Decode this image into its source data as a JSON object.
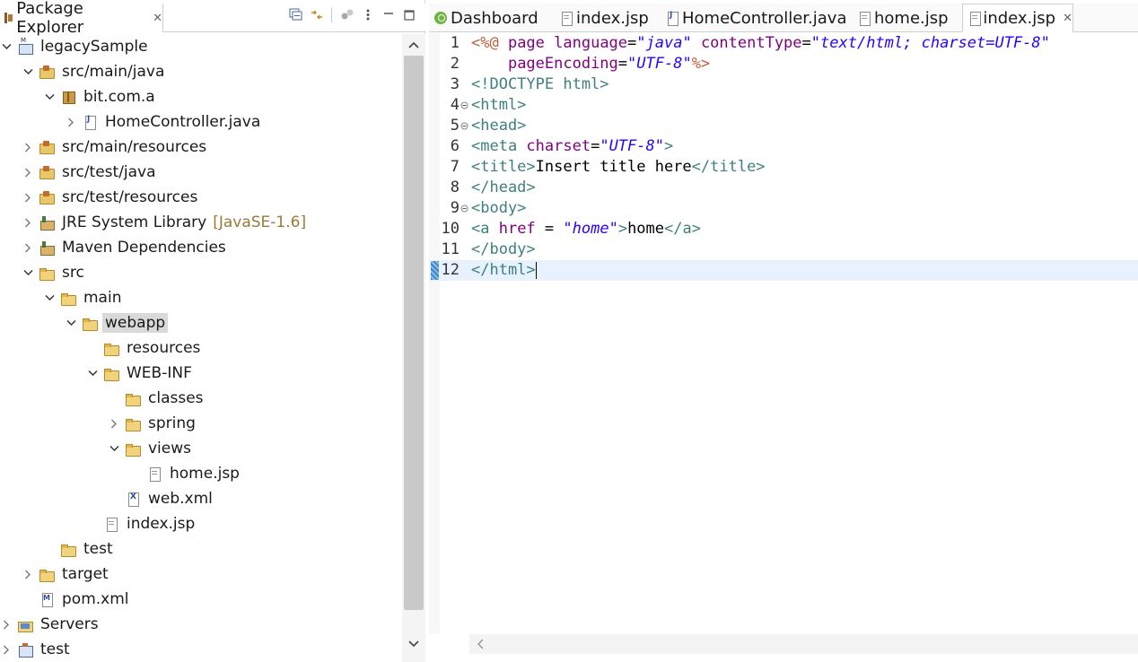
{
  "explorer": {
    "title": "Package Explorer",
    "close_glyph": "✕",
    "tree": [
      {
        "label": "legacySample",
        "icon": "project-icon",
        "twisty": "expanded"
      },
      {
        "label": "src/main/java",
        "icon": "source-folder-icon",
        "twisty": "expanded"
      },
      {
        "label": "bit.com.a",
        "icon": "package-icon",
        "twisty": "expanded"
      },
      {
        "label": "HomeController.java",
        "icon": "java-file-icon",
        "twisty": "collapsed"
      },
      {
        "label": "src/main/resources",
        "icon": "source-folder-icon",
        "twisty": "collapsed"
      },
      {
        "label": "src/test/java",
        "icon": "source-folder-icon",
        "twisty": "collapsed"
      },
      {
        "label": "src/test/resources",
        "icon": "source-folder-icon",
        "twisty": "collapsed"
      },
      {
        "label": "JRE System Library",
        "decor": "[JavaSE-1.6]",
        "icon": "library-icon",
        "twisty": "collapsed"
      },
      {
        "label": "Maven Dependencies",
        "icon": "library-icon",
        "twisty": "collapsed"
      },
      {
        "label": "src",
        "icon": "folder-icon",
        "twisty": "expanded"
      },
      {
        "label": "main",
        "icon": "folder-icon",
        "twisty": "expanded"
      },
      {
        "label": "webapp",
        "icon": "folder-icon",
        "twisty": "expanded",
        "selected": true
      },
      {
        "label": "resources",
        "icon": "folder-icon",
        "twisty": "none"
      },
      {
        "label": "WEB-INF",
        "icon": "folder-icon",
        "twisty": "expanded"
      },
      {
        "label": "classes",
        "icon": "folder-icon",
        "twisty": "none"
      },
      {
        "label": "spring",
        "icon": "folder-icon",
        "twisty": "collapsed"
      },
      {
        "label": "views",
        "icon": "folder-icon",
        "twisty": "expanded"
      },
      {
        "label": "home.jsp",
        "icon": "jsp-file-icon",
        "twisty": "none"
      },
      {
        "label": "web.xml",
        "icon": "xml-file-icon",
        "twisty": "none"
      },
      {
        "label": "index.jsp",
        "icon": "jsp-file-icon",
        "twisty": "none"
      },
      {
        "label": "test",
        "icon": "folder-icon",
        "twisty": "none"
      },
      {
        "label": "target",
        "icon": "folder-icon",
        "twisty": "collapsed"
      },
      {
        "label": "pom.xml",
        "icon": "pom-file-icon",
        "twisty": "none"
      },
      {
        "label": "Servers",
        "icon": "servers-icon",
        "twisty": "collapsed"
      },
      {
        "label": "test",
        "icon": "project-icon",
        "twisty": "collapsed"
      }
    ]
  },
  "editor": {
    "tabs": [
      {
        "label": "Dashboard",
        "icon": "spring-dashboard-icon"
      },
      {
        "label": "index.jsp",
        "icon": "jsp-file-icon"
      },
      {
        "label": "HomeController.java",
        "icon": "java-file-icon"
      },
      {
        "label": "home.jsp",
        "icon": "jsp-file-icon"
      },
      {
        "label": "index.jsp",
        "icon": "jsp-file-icon",
        "active": true
      }
    ],
    "line_numbers": [
      "1",
      "2",
      "3",
      "4",
      "5",
      "6",
      "7",
      "8",
      "9",
      "10",
      "11",
      "12"
    ],
    "folded_lines": [
      "4",
      "5",
      "9"
    ],
    "current_line": "12",
    "lines": [
      [
        [
          "dir",
          "<%@ "
        ],
        [
          "attr",
          "page "
        ],
        [
          "attr",
          "language"
        ],
        [
          "txt",
          "="
        ],
        [
          "str",
          "\"java\" "
        ],
        [
          "attr",
          "contentType"
        ],
        [
          "txt",
          "="
        ],
        [
          "str",
          "\"text/html; charset=UTF-8\""
        ]
      ],
      [
        [
          "txt",
          "    "
        ],
        [
          "attr",
          "pageEncoding"
        ],
        [
          "txt",
          "="
        ],
        [
          "str",
          "\"UTF-8\""
        ],
        [
          "dir",
          "%>"
        ]
      ],
      [
        [
          "tag",
          "<!DOCTYPE html>"
        ]
      ],
      [
        [
          "tag",
          "<html>"
        ]
      ],
      [
        [
          "tag",
          "<head>"
        ]
      ],
      [
        [
          "tag",
          "<meta "
        ],
        [
          "attr",
          "charset"
        ],
        [
          "txt",
          "="
        ],
        [
          "str",
          "\"UTF-8\""
        ],
        [
          "tag",
          ">"
        ]
      ],
      [
        [
          "tag",
          "<title>"
        ],
        [
          "txt",
          "Insert title here"
        ],
        [
          "tag",
          "</title>"
        ]
      ],
      [
        [
          "tag",
          "</head>"
        ]
      ],
      [
        [
          "tag",
          "<body>"
        ]
      ],
      [
        [
          "tag",
          "<a "
        ],
        [
          "attr",
          "href"
        ],
        [
          "txt",
          " = "
        ],
        [
          "str",
          "\"home\""
        ],
        [
          "tag",
          ">"
        ],
        [
          "txt",
          "home"
        ],
        [
          "tag",
          "</a>"
        ]
      ],
      [
        [
          "tag",
          "</body>"
        ]
      ],
      [
        [
          "tag",
          "</html>"
        ]
      ]
    ]
  }
}
